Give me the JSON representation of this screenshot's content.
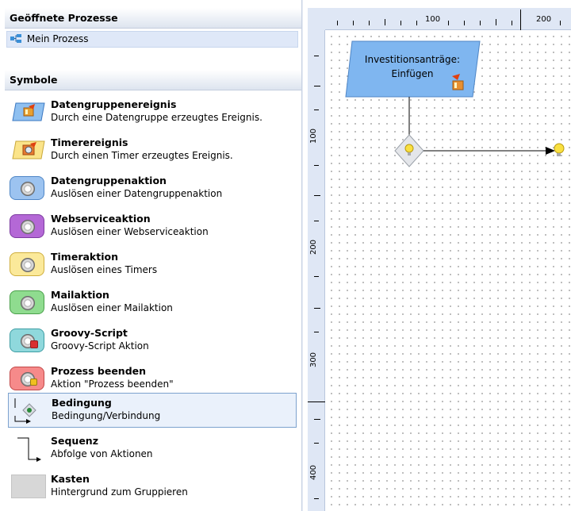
{
  "left_panel": {
    "open_processes_header": "Geöffnete Prozesse",
    "open_processes": [
      {
        "label": "Mein Prozess",
        "icon": "process-icon"
      }
    ],
    "symbols_header": "Symbole",
    "symbols": [
      {
        "title": "Datengruppenereignis",
        "description": "Durch eine Datengruppe erzeugtes Ereignis.",
        "icon": "datagroup-event-icon"
      },
      {
        "title": "Timerereignis",
        "description": "Durch einen Timer erzeugtes Ereignis.",
        "icon": "timer-event-icon"
      },
      {
        "title": "Datengruppenaktion",
        "description": "Auslösen einer Datengruppenaktion",
        "icon": "datagroup-action-icon",
        "color": "#6fa6e6"
      },
      {
        "title": "Webserviceaktion",
        "description": "Auslösen einer Webserviceaktion",
        "icon": "webservice-action-icon",
        "color": "#b05fd0"
      },
      {
        "title": "Timeraktion",
        "description": "Auslösen eines Timers",
        "icon": "timer-action-icon",
        "color": "#f7e27a"
      },
      {
        "title": "Mailaktion",
        "description": "Auslösen einer Mailaktion",
        "icon": "mail-action-icon",
        "color": "#7fd17f"
      },
      {
        "title": "Groovy-Script",
        "description": "Groovy-Script Aktion",
        "icon": "groovy-script-icon",
        "color": "#7fd0d6"
      },
      {
        "title": "Prozess beenden",
        "description": "Aktion \"Prozess beenden\"",
        "icon": "end-process-icon",
        "color": "#f27c7c"
      },
      {
        "title": "Bedingung",
        "description": "Bedingung/Verbindung",
        "icon": "condition-icon",
        "selected": true
      },
      {
        "title": "Sequenz",
        "description": "Abfolge von Aktionen",
        "icon": "sequence-icon"
      },
      {
        "title": "Kasten",
        "description": "Hintergrund zum Gruppieren",
        "icon": "box-icon"
      }
    ]
  },
  "canvas": {
    "ruler_top_labels": [
      "100",
      "200"
    ],
    "ruler_left_labels": [
      "100",
      "200",
      "300",
      "400"
    ],
    "event_node": {
      "line1": "Investitionsanträge:",
      "line2": "Einfügen"
    }
  },
  "colors": {
    "panel_header": "#dde4ef",
    "selection": "#eaf1fb",
    "ruler": "#dfe7f5",
    "node_fill": "#7fb6f0"
  }
}
